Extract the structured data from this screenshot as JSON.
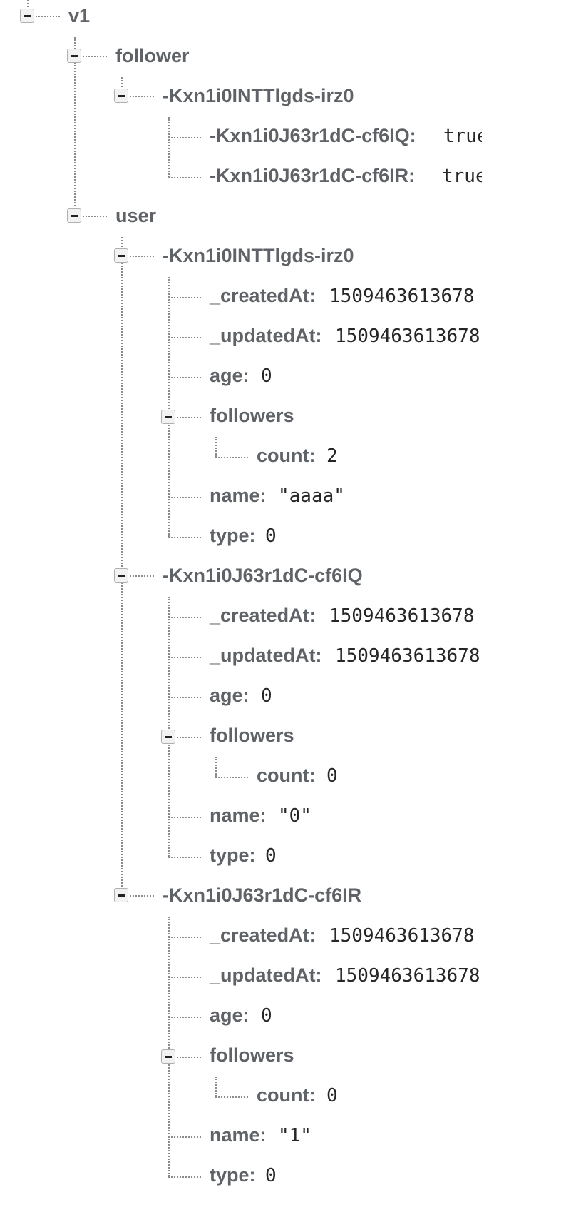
{
  "tree": {
    "root": {
      "key": "v1"
    },
    "follower": {
      "key": "follower",
      "parent": {
        "key": "-Kxn1i0INTTlgds-irz0"
      },
      "children": [
        {
          "key": "-Kxn1i0J63r1dC-cf6IQ",
          "value": "true"
        },
        {
          "key": "-Kxn1i0J63r1dC-cf6IR",
          "value": "true"
        }
      ]
    },
    "user": {
      "key": "user",
      "records": [
        {
          "id": "-Kxn1i0INTTlgds-irz0",
          "createdAt_key": "_createdAt",
          "createdAt": "1509463613678",
          "updatedAt_key": "_updatedAt",
          "updatedAt": "1509463613678",
          "age_key": "age",
          "age": "0",
          "followers_key": "followers",
          "count_key": "count",
          "count": "2",
          "name_key": "name",
          "name": "\"aaaa\"",
          "type_key": "type",
          "type": "0"
        },
        {
          "id": "-Kxn1i0J63r1dC-cf6IQ",
          "createdAt_key": "_createdAt",
          "createdAt": "1509463613678",
          "updatedAt_key": "_updatedAt",
          "updatedAt": "1509463613678",
          "age_key": "age",
          "age": "0",
          "followers_key": "followers",
          "count_key": "count",
          "count": "0",
          "name_key": "name",
          "name": "\"0\"",
          "type_key": "type",
          "type": "0"
        },
        {
          "id": "-Kxn1i0J63r1dC-cf6IR",
          "createdAt_key": "_createdAt",
          "createdAt": "1509463613678",
          "updatedAt_key": "_updatedAt",
          "updatedAt": "1509463613678",
          "age_key": "age",
          "age": "0",
          "followers_key": "followers",
          "count_key": "count",
          "count": "0",
          "name_key": "name",
          "name": "\"1\"",
          "type_key": "type",
          "type": "0"
        }
      ]
    }
  }
}
